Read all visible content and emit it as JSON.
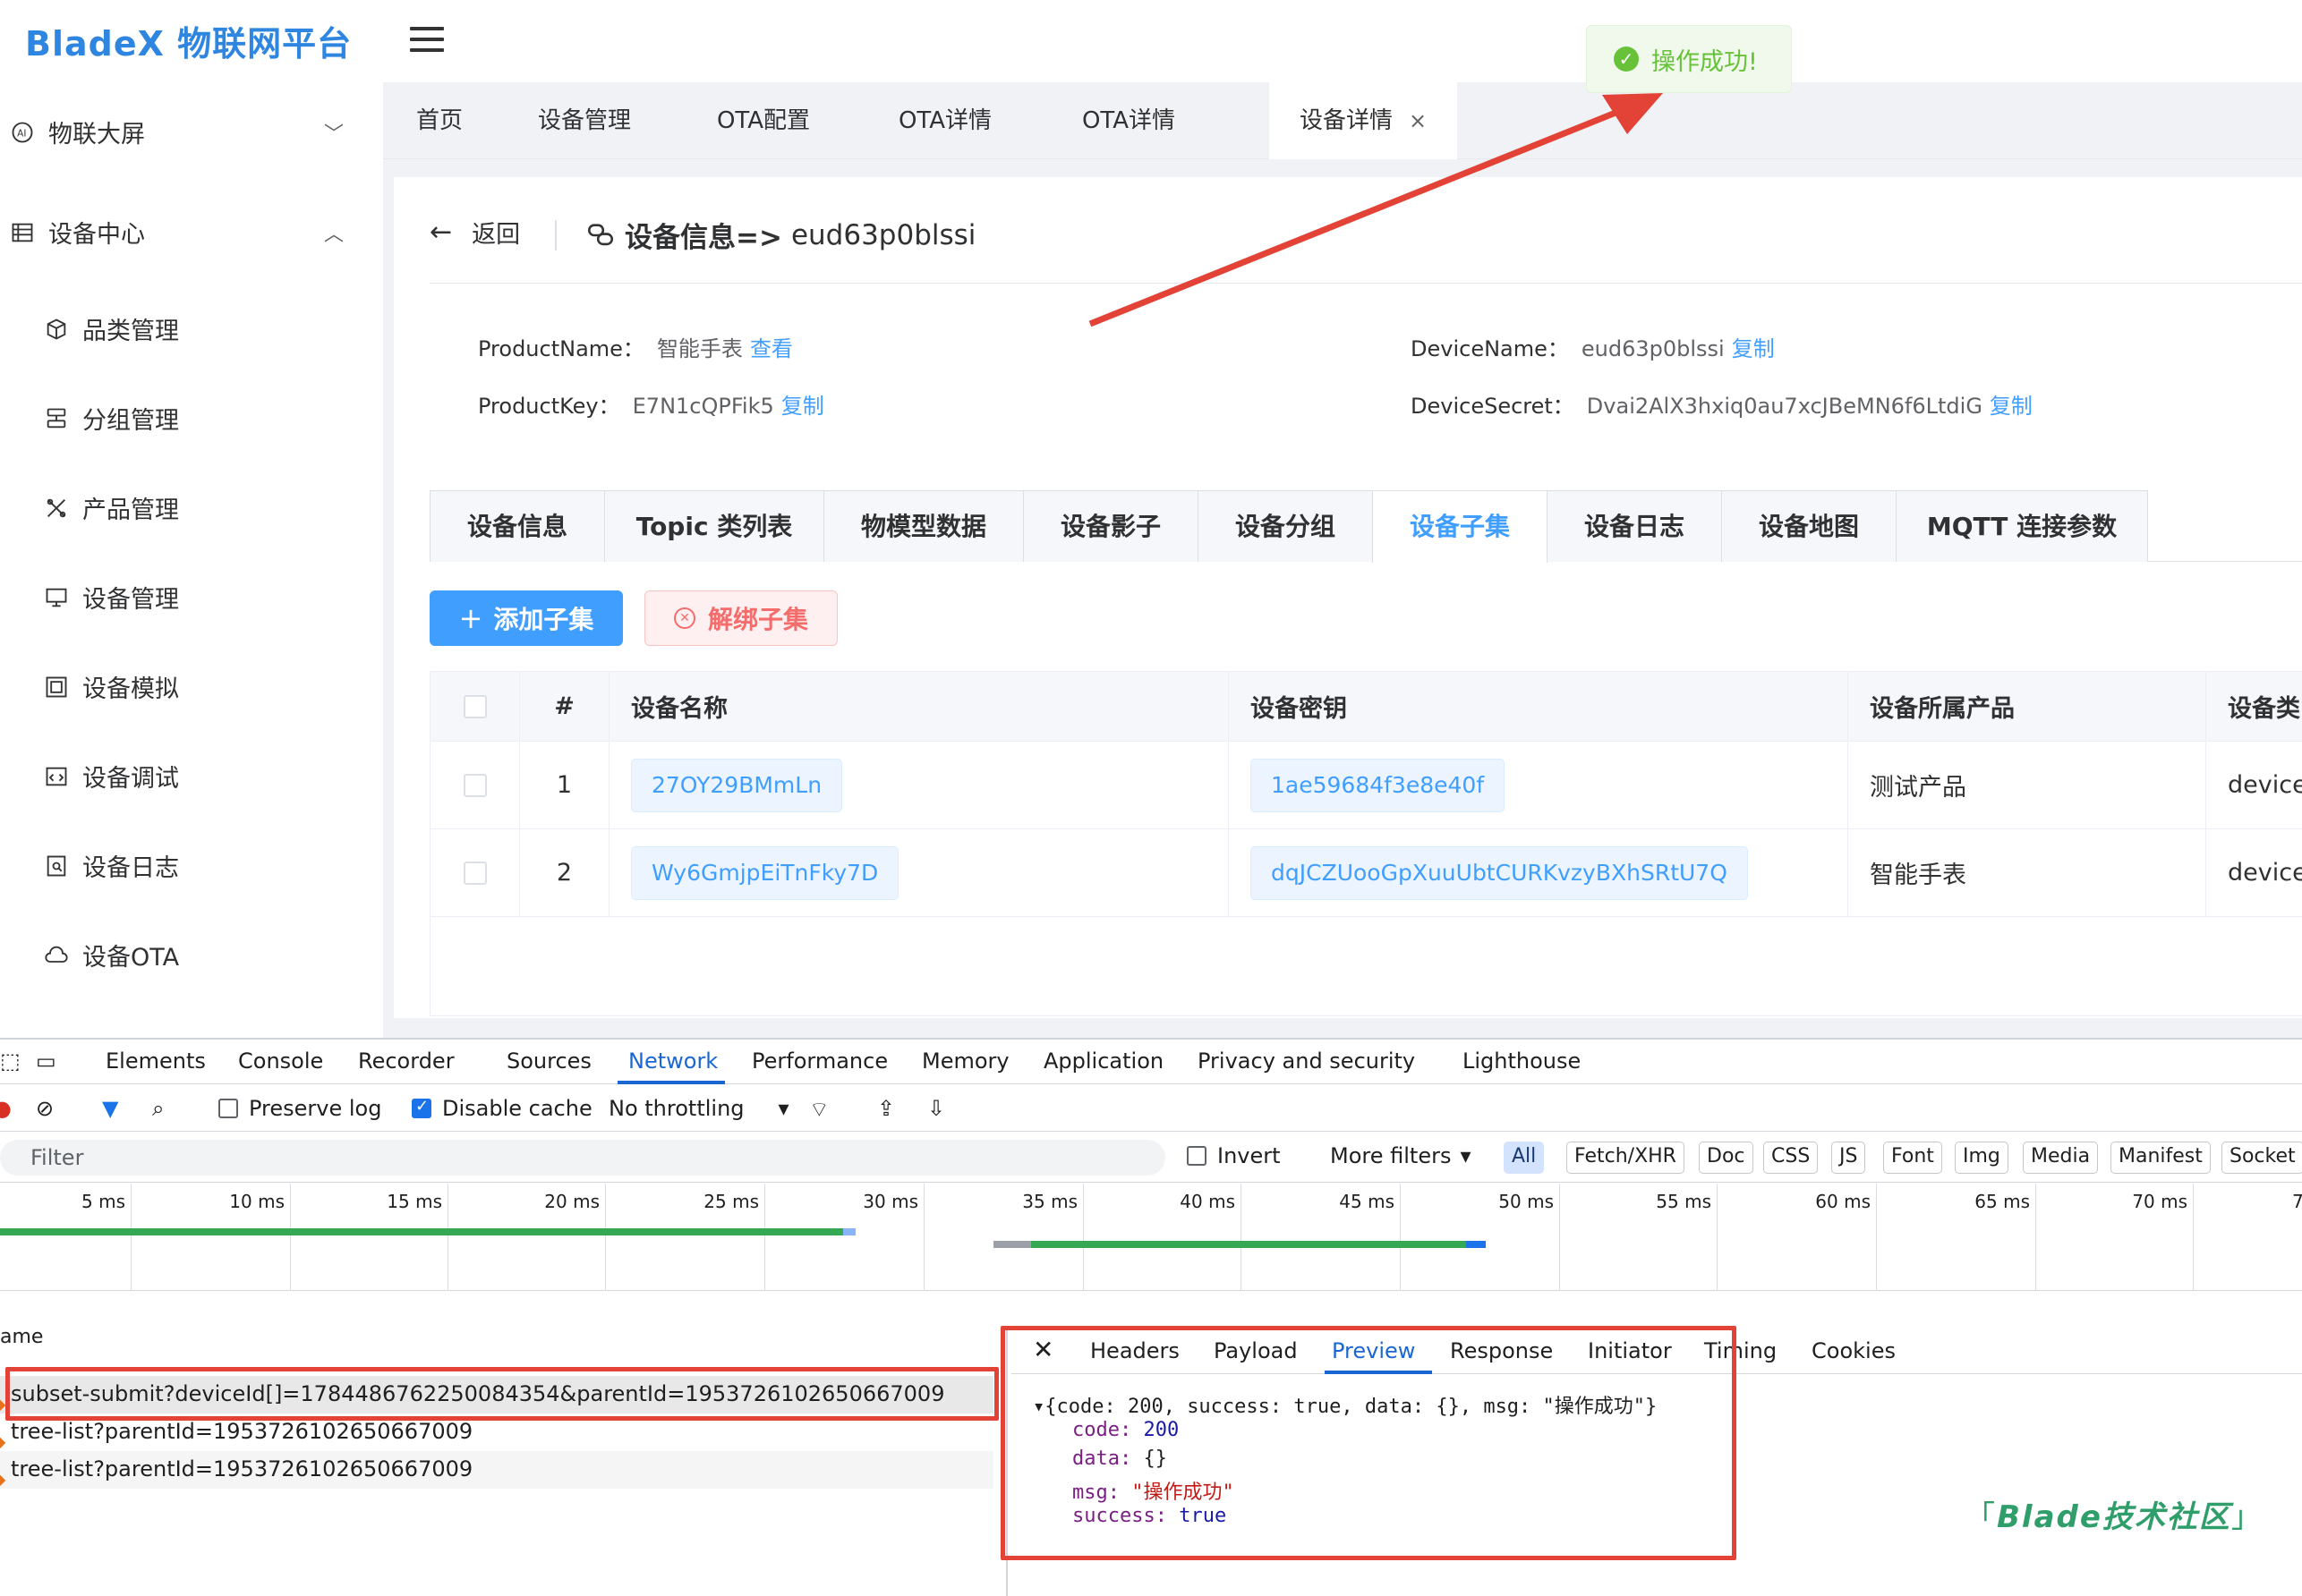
{
  "logo": "BladeX 物联网平台",
  "sidebar": {
    "groups": [
      {
        "label": "物联大屏",
        "icon": "ai-screen-icon",
        "caret": "﹀"
      },
      {
        "label": "设备中心",
        "icon": "list-icon",
        "caret": "︿"
      }
    ],
    "items": [
      {
        "label": "品类管理",
        "icon": "cube-icon"
      },
      {
        "label": "分组管理",
        "icon": "group-icon"
      },
      {
        "label": "产品管理",
        "icon": "tools-icon"
      },
      {
        "label": "设备管理",
        "icon": "monitor-icon"
      },
      {
        "label": "设备模拟",
        "icon": "simulate-icon"
      },
      {
        "label": "设备调试",
        "icon": "debug-icon"
      },
      {
        "label": "设备日志",
        "icon": "log-icon"
      },
      {
        "label": "设备OTA",
        "icon": "cloud-icon"
      }
    ]
  },
  "tabs": [
    "首页",
    "设备管理",
    "OTA配置",
    "OTA详情",
    "OTA详情",
    "设备详情"
  ],
  "tab_close": "×",
  "toast": {
    "text": "操作成功!",
    "icon": "check-circle-icon",
    "color": "#67c23a"
  },
  "header": {
    "back": "返回",
    "title_prefix": "设备信息=>",
    "device_id": "eud63p0blssi"
  },
  "info": {
    "product_name_label": "ProductName：",
    "product_name": "智能手表",
    "product_name_link": "查看",
    "product_key_label": "ProductKey：",
    "product_key": "E7N1cQPFik5",
    "product_key_link": "复制",
    "device_name_label": "DeviceName：",
    "device_name": "eud63p0blssi",
    "device_name_link": "复制",
    "device_secret_label": "DeviceSecret：",
    "device_secret": "Dvai2AlX3hxiq0au7xcJBeMN6f6LtdiG",
    "device_secret_link": "复制"
  },
  "inner_tabs": [
    "设备信息",
    "Topic 类列表",
    "物模型数据",
    "设备影子",
    "设备分组",
    "设备子集",
    "设备日志",
    "设备地图",
    "MQTT 连接参数"
  ],
  "buttons": {
    "add": "添加子集",
    "unbind": "解绑子集"
  },
  "table": {
    "columns": [
      "#",
      "设备名称",
      "设备密钥",
      "设备所属产品",
      "设备类"
    ],
    "rows": [
      {
        "no": "1",
        "name": "27OY29BMmLn",
        "secret": "1ae59684f3e8e40f",
        "product": "测试产品",
        "type": "device"
      },
      {
        "no": "2",
        "name": "Wy6GmjpEiTnFky7D",
        "secret": "dqJCZUooGpXuuUbtCURKvzyBXhSRtU7Q",
        "product": "智能手表",
        "type": "device"
      }
    ]
  },
  "devtools": {
    "tabs": [
      "Elements",
      "Console",
      "Recorder",
      "Sources",
      "Network",
      "Performance",
      "Memory",
      "Application",
      "Privacy and security",
      "Lighthouse"
    ],
    "preserve_log": "Preserve log",
    "disable_cache": "Disable cache",
    "throttling": "No throttling",
    "filter_placeholder": "Filter",
    "invert": "Invert",
    "more_filters": "More filters",
    "chips": [
      "All",
      "Fetch/XHR",
      "Doc",
      "CSS",
      "JS",
      "Font",
      "Img",
      "Media",
      "Manifest",
      "Socket"
    ],
    "ticks": [
      "5 ms",
      "10 ms",
      "15 ms",
      "20 ms",
      "25 ms",
      "30 ms",
      "35 ms",
      "40 ms",
      "45 ms",
      "50 ms",
      "55 ms",
      "60 ms",
      "65 ms",
      "70 ms",
      "7"
    ],
    "name_header": "ame",
    "requests": [
      "subset-submit?deviceId[]=1784486762250084354&parentId=1953726102650667009",
      "tree-list?parentId=1953726102650667009",
      "tree-list?parentId=1953726102650667009"
    ],
    "preview_tabs": [
      "Headers",
      "Payload",
      "Preview",
      "Response",
      "Initiator",
      "Timing",
      "Cookies"
    ],
    "preview": {
      "summary": "{code: 200, success: true, data: {}, msg: \"操作成功\"}",
      "code_key": "code:",
      "code_val": "200",
      "data_key": "data:",
      "data_val": "{}",
      "msg_key": "msg:",
      "msg_val": "\"操作成功\"",
      "success_key": "success:",
      "success_val": "true"
    }
  },
  "watermark": "Blade技术社区",
  "colors": {
    "primary": "#409eff",
    "success": "#67c23a",
    "danger": "#f56c6c",
    "annotation": "#e34336"
  }
}
